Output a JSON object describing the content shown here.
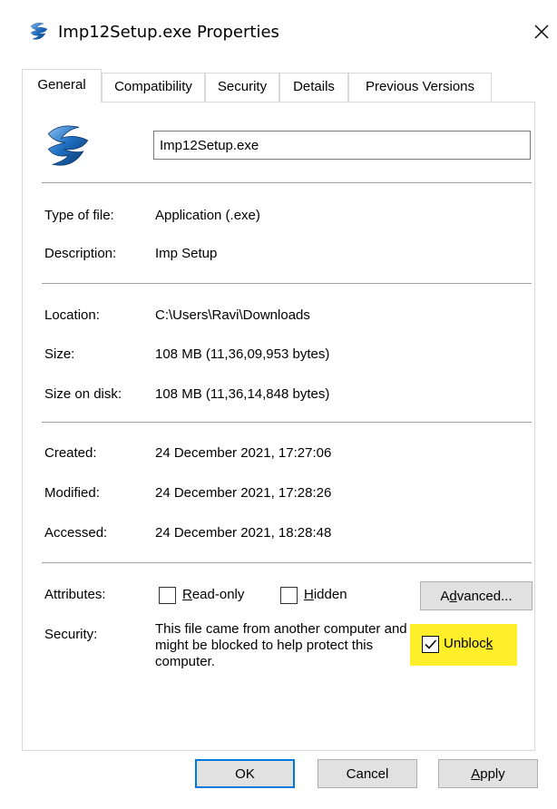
{
  "window": {
    "title": "Imp12Setup.exe Properties",
    "close_glyph": "✕"
  },
  "tabs": [
    {
      "label": "General",
      "active": true
    },
    {
      "label": "Compatibility",
      "active": false
    },
    {
      "label": "Security",
      "active": false
    },
    {
      "label": "Details",
      "active": false
    },
    {
      "label": "Previous Versions",
      "active": false
    }
  ],
  "general": {
    "file_name": "Imp12Setup.exe",
    "type_label": "Type of file:",
    "type_value": "Application (.exe)",
    "description_label": "Description:",
    "description_value": "Imp Setup",
    "location_label": "Location:",
    "location_value": "C:\\Users\\Ravi\\Downloads",
    "size_label": "Size:",
    "size_value": "108 MB (11,36,09,953 bytes)",
    "size_on_disk_label": "Size on disk:",
    "size_on_disk_value": "108 MB (11,36,14,848 bytes)",
    "created_label": "Created:",
    "created_value": "24 December 2021, 17:27:06",
    "modified_label": "Modified:",
    "modified_value": "24 December 2021, 17:28:26",
    "accessed_label": "Accessed:",
    "accessed_value": "24 December 2021, 18:28:48",
    "attributes_label": "Attributes:",
    "readonly": {
      "accel": "R",
      "rest": "ead-only",
      "checked": false
    },
    "hidden": {
      "accel": "H",
      "rest": "idden",
      "checked": false
    },
    "advanced": {
      "pre": "A",
      "accel": "d",
      "rest": "vanced..."
    },
    "security_label": "Security:",
    "security_text": "This file came from another computer and might be blocked to help protect this computer.",
    "unblock": {
      "pre": "Unbloc",
      "accel": "k",
      "checked": true
    }
  },
  "buttons": {
    "ok": "OK",
    "cancel": "Cancel",
    "apply_accel": "A",
    "apply_rest": "pply"
  },
  "colors": {
    "highlight": "#ffef2a",
    "default_button_border": "#0078d7",
    "icon_blue": "#1f6fc2"
  },
  "icons": {
    "app_icon": "imp-setup-icon",
    "close": "close-icon",
    "check": "checkmark-icon"
  }
}
